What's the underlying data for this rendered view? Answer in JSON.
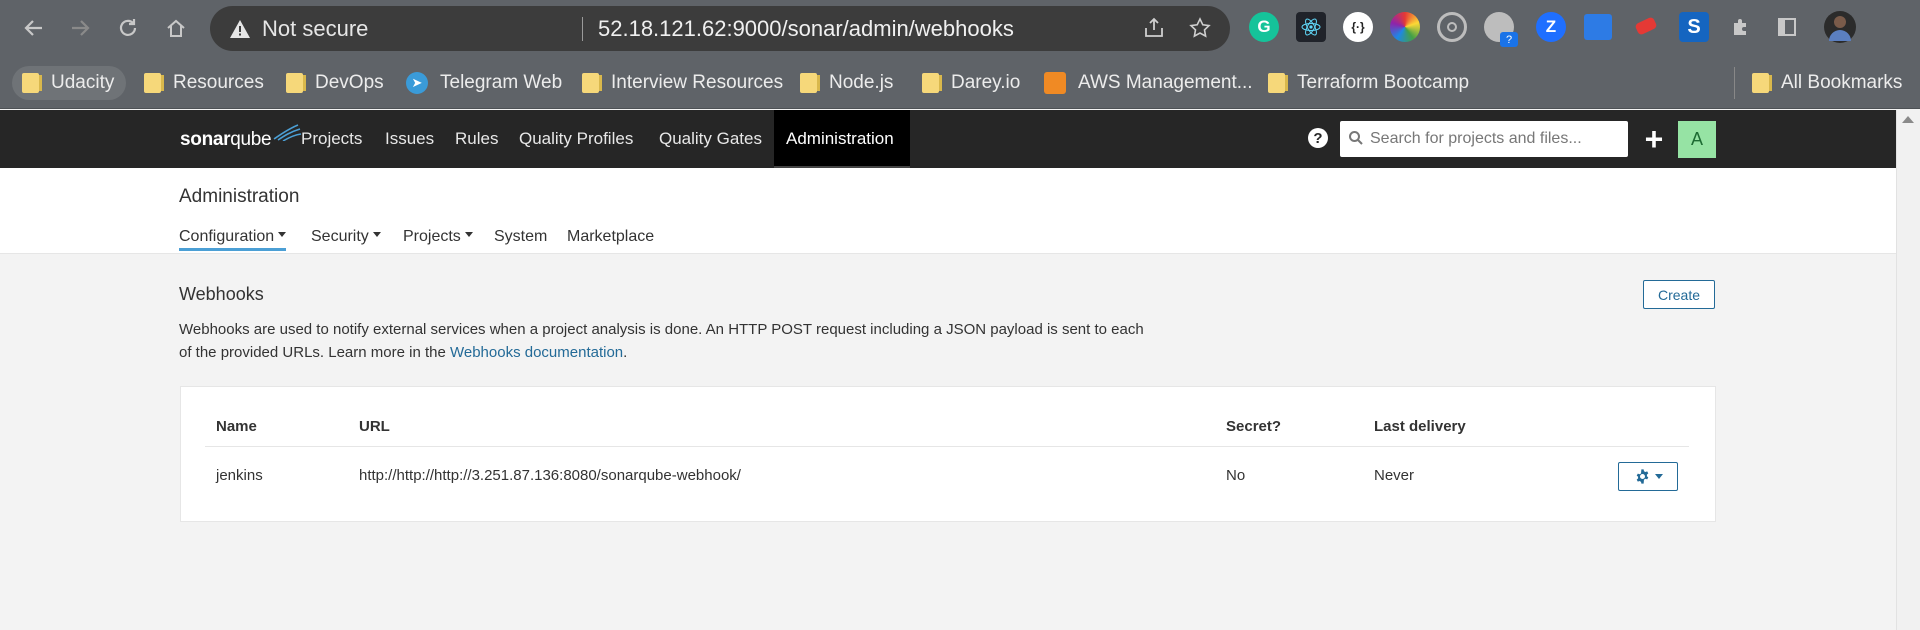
{
  "browser": {
    "security_label": "Not secure",
    "url": "52.18.121.62:9000/sonar/admin/webhooks",
    "bookmarks": [
      "Udacity",
      "Resources",
      "DevOps",
      "Telegram Web",
      "Interview Resources",
      "Node.js",
      "Darey.io",
      "AWS Management...",
      "Terraform Bootcamp"
    ],
    "all_bookmarks": "All Bookmarks",
    "extension_badge": "?"
  },
  "sonar_nav": {
    "logo_sonar": "sonar",
    "logo_qube": "qube",
    "links": [
      "Projects",
      "Issues",
      "Rules",
      "Quality Profiles",
      "Quality Gates",
      "Administration"
    ],
    "active_link": "Administration",
    "help": "?",
    "search_placeholder": "Search for projects and files...",
    "plus": "+",
    "avatar": "A"
  },
  "admin": {
    "title": "Administration",
    "subnav": [
      "Configuration",
      "Security",
      "Projects",
      "System",
      "Marketplace"
    ]
  },
  "webhooks": {
    "title": "Webhooks",
    "create_label": "Create",
    "description": "Webhooks are used to notify external services when a project analysis is done. An HTTP POST request including a JSON payload is sent to each of the provided URLs. Learn more in the ",
    "doc_link": "Webhooks documentation",
    "doc_suffix": ".",
    "columns": [
      "Name",
      "URL",
      "Secret?",
      "Last delivery"
    ],
    "rows": [
      {
        "name": "jenkins",
        "url": "http://http://http://3.251.87.136:8080/sonarqube-webhook/",
        "secret": "No",
        "last_delivery": "Never"
      }
    ]
  },
  "colors": {
    "nav_bg": "#262626",
    "accent_link": "#236a97",
    "active_tab_underline": "#4b9fd5",
    "avatar_bg": "#96e3a4"
  }
}
